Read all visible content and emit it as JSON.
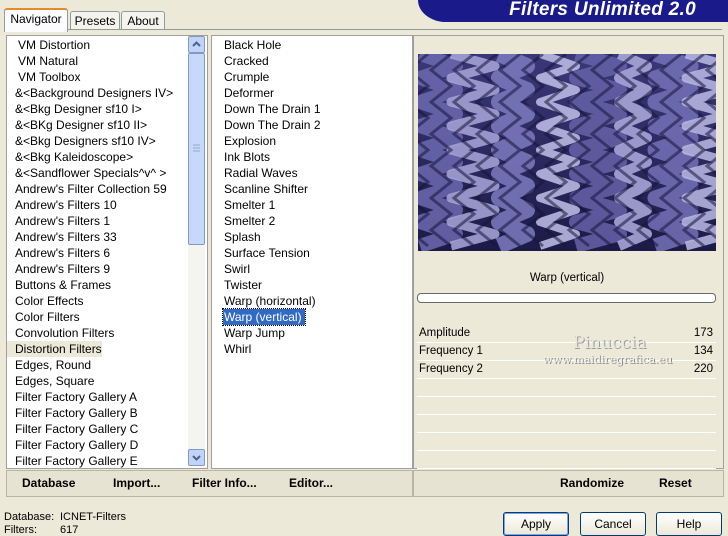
{
  "tabs": [
    "Navigator",
    "Presets",
    "About"
  ],
  "banner_title": "Filters Unlimited 2.0",
  "categories": [
    "VM Distortion",
    "VM Natural",
    "VM Toolbox",
    "&<Background Designers IV>",
    "&<Bkg Designer sf10 I>",
    "&<BKg Designer sf10 II>",
    "&<Bkg Designers sf10 IV>",
    "&<Bkg Kaleidoscope>",
    "&<Sandflower Specials^v^ >",
    "Andrew's Filter Collection 59",
    "Andrew's Filters 10",
    "Andrew's Filters 1",
    "Andrew's Filters 33",
    "Andrew's Filters 6",
    "Andrew's Filters 9",
    "Buttons & Frames",
    "Color Effects",
    "Color Filters",
    "Convolution Filters",
    "Distortion Filters",
    "Edges, Round",
    "Edges, Square",
    "Filter Factory Gallery A",
    "Filter Factory Gallery B",
    "Filter Factory Gallery C",
    "Filter Factory Gallery D",
    "Filter Factory Gallery E"
  ],
  "selected_category": "Distortion Filters",
  "filters": [
    "Black Hole",
    "Cracked",
    "Crumple",
    "Deformer",
    "Down The Drain 1",
    "Down The Drain 2",
    "Explosion",
    "Ink Blots",
    "Radial Waves",
    "Scanline Shifter",
    "Smelter 1",
    "Smelter 2",
    "Splash",
    "Surface Tension",
    "Swirl",
    "Twister",
    "Warp (horizontal)",
    "Warp (vertical)",
    "Warp Jump",
    "Whirl"
  ],
  "selected_filter": "Warp (vertical)",
  "preview_caption": "Warp (vertical)",
  "params": [
    {
      "name": "Amplitude",
      "value": "173"
    },
    {
      "name": "Frequency 1",
      "value": "134"
    },
    {
      "name": "Frequency 2",
      "value": "220"
    }
  ],
  "watermark": {
    "name": "Pinuccia",
    "url": "www.maidiregrafica.eu"
  },
  "bottom_links": {
    "database": "Database",
    "import": "Import...",
    "filter_info": "Filter Info...",
    "editor": "Editor..."
  },
  "right_links": {
    "randomize": "Randomize",
    "reset": "Reset"
  },
  "buttons": {
    "apply": "Apply",
    "cancel": "Cancel",
    "help": "Help"
  },
  "status": {
    "db_label": "Database:",
    "db_value": "ICNET-Filters",
    "filters_label": "Filters:",
    "filters_value": "617"
  },
  "colors": {
    "selection_blue": "#316ac5",
    "banner": "#1a1a8a",
    "tab_highlight": "#e68b2c"
  }
}
